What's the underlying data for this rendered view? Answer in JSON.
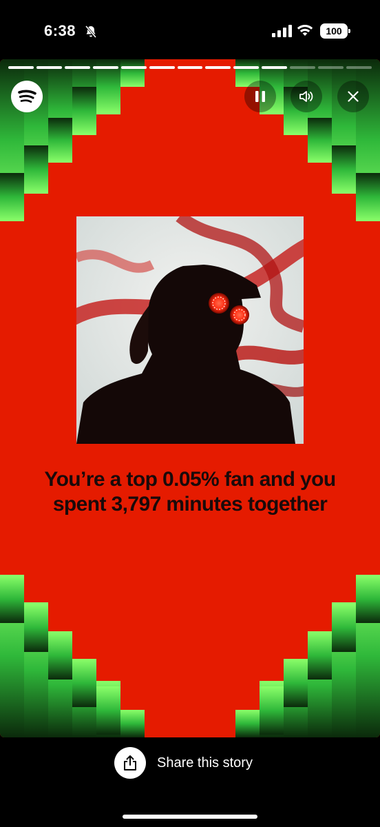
{
  "status_bar": {
    "time": "6:38",
    "battery": "100"
  },
  "story": {
    "progress_total": 13,
    "progress_completed": 10,
    "headline": "You’re a top 0.05% fan and you spent 3,797 minutes together",
    "background_color": "#E51B00",
    "pixel_colors": [
      "#0b2a0b",
      "#1f8a2a",
      "#3fd94a",
      "#8bff6a"
    ]
  },
  "controls": {
    "logo_icon": "spotify-icon",
    "pause_icon": "pause-icon",
    "sound_icon": "speaker-icon",
    "close_icon": "close-icon"
  },
  "footer": {
    "share_label": "Share this story",
    "share_icon": "share-icon"
  }
}
